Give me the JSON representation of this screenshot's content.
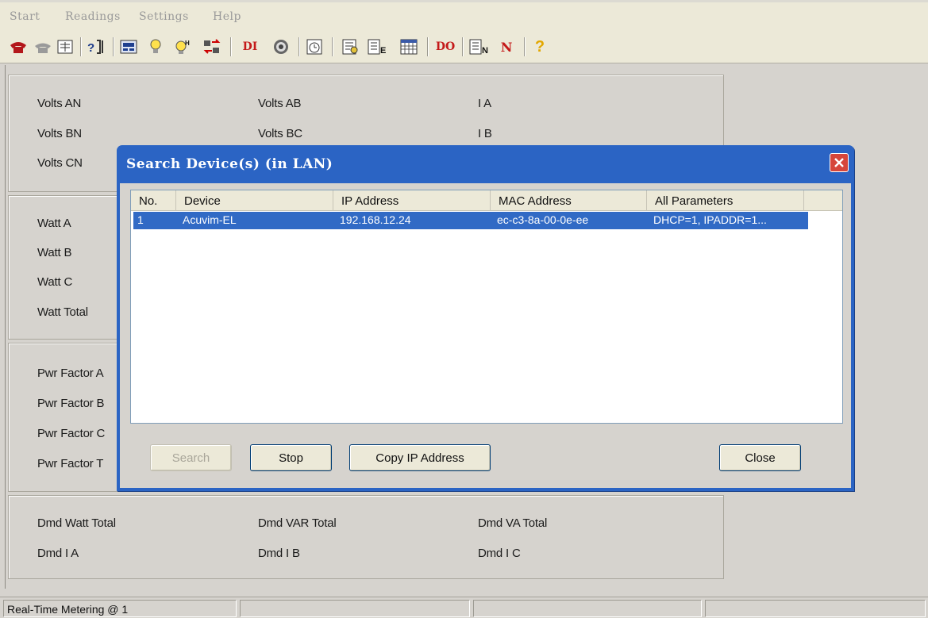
{
  "menubar": {
    "items": [
      "Start",
      "Readings",
      "Settings",
      "Help"
    ]
  },
  "toolbar": {
    "di_label": "DI",
    "do_label": "DO",
    "n_label": "N",
    "help_label": "?",
    "icons": [
      "phone-connect-icon",
      "phone-disconnect-icon",
      "device-list-icon",
      "query-icon",
      "meter-display-icon",
      "lamp-icon",
      "lamp-harmonics-icon",
      "transfer-icon",
      "di-icon",
      "dial-icon",
      "clock-icon",
      "report-icon",
      "energy-icon",
      "calendar-icon",
      "do-icon",
      "energy-n-icon",
      "n-icon",
      "help-icon"
    ]
  },
  "meter": {
    "group1": {
      "col1": [
        "Volts AN",
        "Volts BN",
        "Volts CN"
      ],
      "col2": [
        "Volts AB",
        "Volts BC"
      ],
      "col3": [
        "I A",
        "I B"
      ]
    },
    "group2": {
      "col1": [
        "Watt A",
        "Watt B",
        "Watt C",
        "Watt Total"
      ]
    },
    "group3": {
      "col1": [
        "Pwr Factor A",
        "Pwr Factor B",
        "Pwr Factor C",
        "Pwr Factor T"
      ]
    },
    "group4": {
      "col1": [
        "Dmd Watt Total",
        "Dmd I A"
      ],
      "col2": [
        "Dmd VAR Total",
        "Dmd I B"
      ],
      "col3": [
        "Dmd VA Total",
        "Dmd I C"
      ]
    }
  },
  "dialog": {
    "title": "Search Device(s) (in LAN)",
    "columns": [
      "No.",
      "Device",
      "IP Address",
      "MAC Address",
      "All Parameters"
    ],
    "rows": [
      {
        "no": "1",
        "device": "Acuvim-EL",
        "ip": "192.168.12.24",
        "mac": "ec-c3-8a-00-0e-ee",
        "params": "DHCP=1, IPADDR=1..."
      }
    ],
    "buttons": {
      "search": "Search",
      "stop": "Stop",
      "copy_ip": "Copy IP Address",
      "close": "Close"
    }
  },
  "statusbar": {
    "text": "Real-Time Metering @ 1"
  },
  "colors": {
    "dialog_frame": "#2b64c4",
    "selection": "#316ac5",
    "close_button": "#d6463b",
    "window_bg": "#d6d3ce"
  }
}
